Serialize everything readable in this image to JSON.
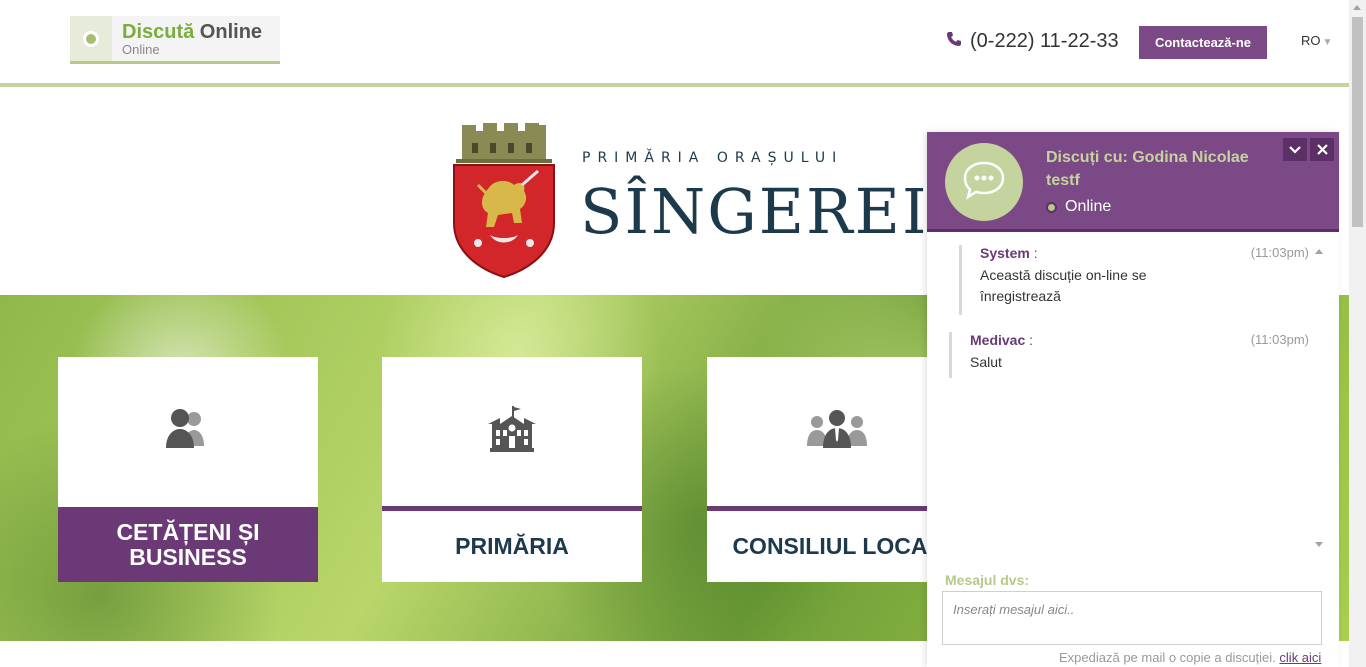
{
  "header": {
    "chat_widget": {
      "title_highlight": "Discută",
      "title_rest": " Online",
      "status": "Online"
    },
    "phone": "(0-222) 11-22-33",
    "contact_label": "Contactează-ne",
    "language": "RO"
  },
  "logo": {
    "subtitle": "PRIMĂRIA ORAȘULUI",
    "title": "SÎNGEREI"
  },
  "tiles": [
    {
      "label_line1": "CETĂȚENI ȘI",
      "label_line2": "BUSINESS",
      "icon": "citizens-icon",
      "active": true
    },
    {
      "label_line1": "PRIMĂRIA",
      "label_line2": "",
      "icon": "town-hall-icon",
      "active": false
    },
    {
      "label_line1": "CONSILIUL LOCAL",
      "label_line2": "",
      "icon": "council-icon",
      "active": false
    }
  ],
  "chat": {
    "title": "Discuți cu: Godina Nicolae testf",
    "status": "Online",
    "messages": [
      {
        "author": "System",
        "colon": " :",
        "time": "(11:03pm)",
        "text": "Această discuție on-line se înregistrează"
      },
      {
        "author": "Medivac",
        "colon": " :",
        "time": "(11:03pm)",
        "text": "Salut"
      }
    ],
    "input_label": "Mesajul dvs:",
    "input_placeholder": "Inserați mesajul aici..",
    "footer_text": "Expediază pe mail o copie a discuției.",
    "footer_link": "clik aici"
  },
  "colors": {
    "accent_purple": "#7b4a86",
    "accent_green": "#c5d39f",
    "text_dark": "#1d3a4d"
  }
}
